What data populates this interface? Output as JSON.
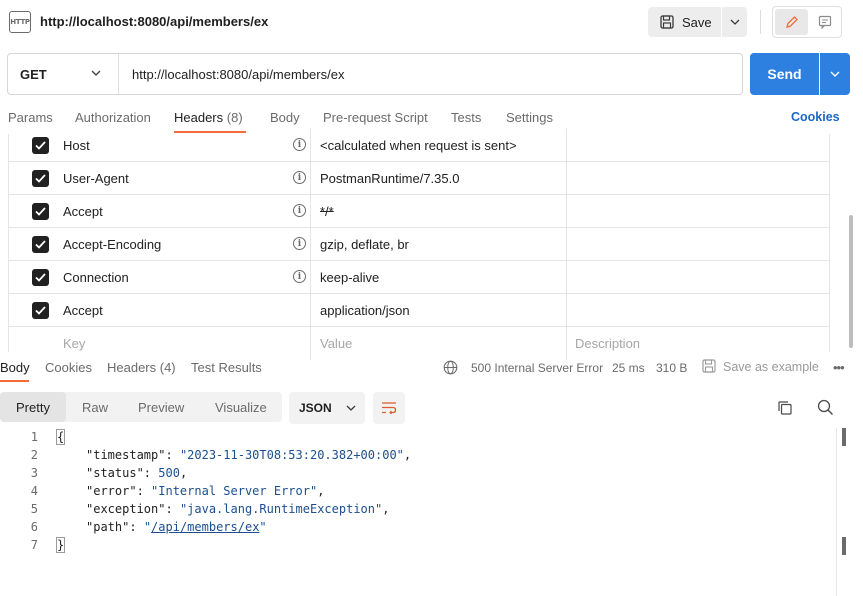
{
  "request": {
    "title": "http://localhost:8080/api/members/ex",
    "icon_label": "HTTP",
    "save_label": "Save",
    "method": "GET",
    "url": "http://localhost:8080/api/members/ex",
    "send_label": "Send"
  },
  "request_tabs": {
    "params": "Params",
    "authorization": "Authorization",
    "headers": "Headers",
    "headers_count": "(8)",
    "body": "Body",
    "prerequest": "Pre-request Script",
    "tests": "Tests",
    "settings": "Settings",
    "cookies": "Cookies"
  },
  "headers": [
    {
      "key": "Host",
      "value": "<calculated when request is sent>"
    },
    {
      "key": "User-Agent",
      "value": "PostmanRuntime/7.35.0"
    },
    {
      "key": "Accept",
      "value": "*/*"
    },
    {
      "key": "Accept-Encoding",
      "value": "gzip, deflate, br"
    },
    {
      "key": "Connection",
      "value": "keep-alive"
    },
    {
      "key": "Accept",
      "value": "application/json"
    }
  ],
  "headers_placeholder": {
    "key": "Key",
    "value": "Value",
    "description": "Description"
  },
  "response_tabs": {
    "body": "Body",
    "cookies": "Cookies",
    "headers": "Headers (4)",
    "test_results": "Test Results"
  },
  "response_meta": {
    "status": "500 Internal Server Error",
    "time": "25 ms",
    "size": "310 B",
    "save_example": "Save as example"
  },
  "view_tabs": {
    "pretty": "Pretty",
    "raw": "Raw",
    "preview": "Preview",
    "visualize": "Visualize",
    "format": "JSON"
  },
  "code_lines": {
    "l1": "{",
    "timestamp_key": "\"timestamp\"",
    "timestamp_val": "\"2023-11-30T08:53:20.382+00:00\"",
    "status_key": "\"status\"",
    "status_val": "500",
    "error_key": "\"error\"",
    "error_val": "\"Internal Server Error\"",
    "exception_key": "\"exception\"",
    "exception_val": "\"java.lang.RuntimeException\"",
    "path_key": "\"path\"",
    "path_val": "/api/members/ex",
    "l7": "}"
  },
  "line_numbers": [
    "1",
    "2",
    "3",
    "4",
    "5",
    "6",
    "7"
  ],
  "colors": {
    "send_blue": "#2d7fe0",
    "active_tab_orange": "#f26b3a",
    "link_blue": "#1a66c9"
  }
}
